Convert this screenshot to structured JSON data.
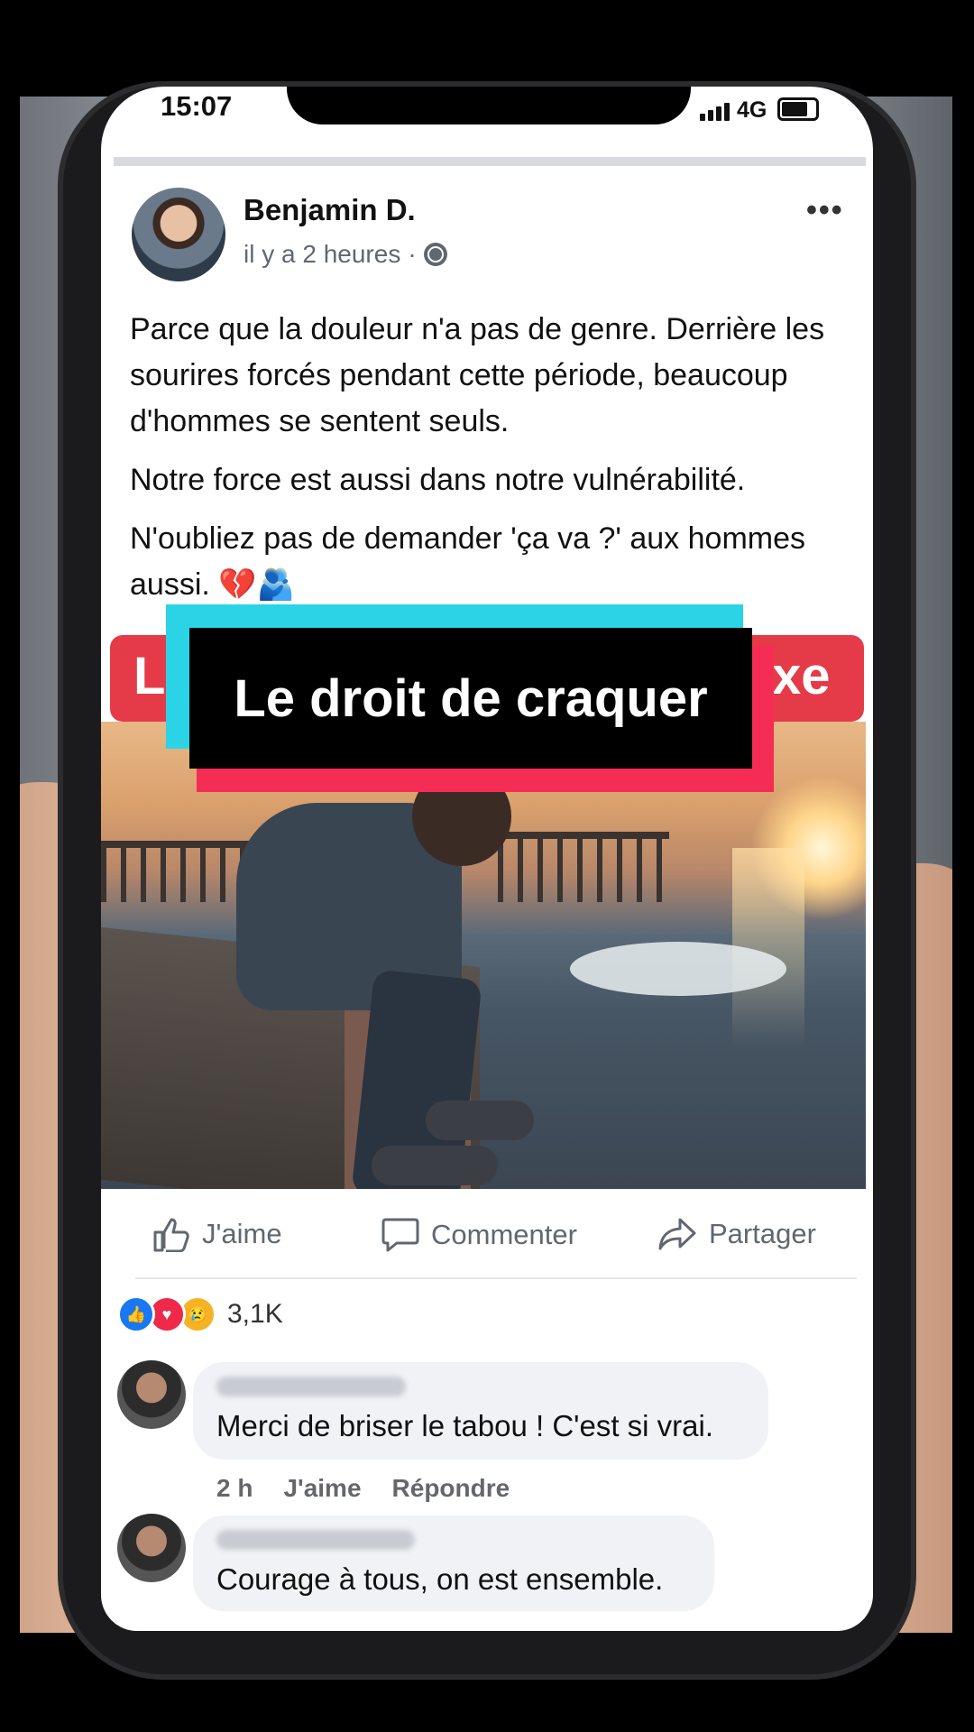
{
  "status_bar": {
    "time": "15:07",
    "network": "4G"
  },
  "post": {
    "author": "Benjamin D.",
    "time": "il y a 2 heures",
    "paragraphs": [
      "Parce que la douleur n'a pas de genre. Derrière les sourires forcés pendant cette période, beaucoup d'hommes se sentent seuls.",
      "Notre force est aussi dans notre vulnérabilité.",
      "N'oubliez pas de demander 'ça va ?' aux hommes aussi. 💔🫂"
    ],
    "more_label": "•••"
  },
  "badge": {
    "left": "L",
    "right": "xe"
  },
  "overlay_title": "Le droit de craquer",
  "actions": {
    "like": "J'aime",
    "comment": "Commenter",
    "share": "Partager"
  },
  "reactions": {
    "count": "3,1K",
    "icons": [
      "like-icon",
      "love-icon",
      "sad-icon"
    ]
  },
  "comments": [
    {
      "text": "Merci de briser le tabou ! C'est si vrai.",
      "time": "2 h",
      "like": "J'aime",
      "reply": "Répondre"
    },
    {
      "text": "Courage à tous, on est ensemble."
    }
  ],
  "colors": {
    "accent_red": "#e53b48",
    "cyan": "#2ad4e6",
    "pink": "#f52d55",
    "facebook_blue": "#1877f2"
  }
}
